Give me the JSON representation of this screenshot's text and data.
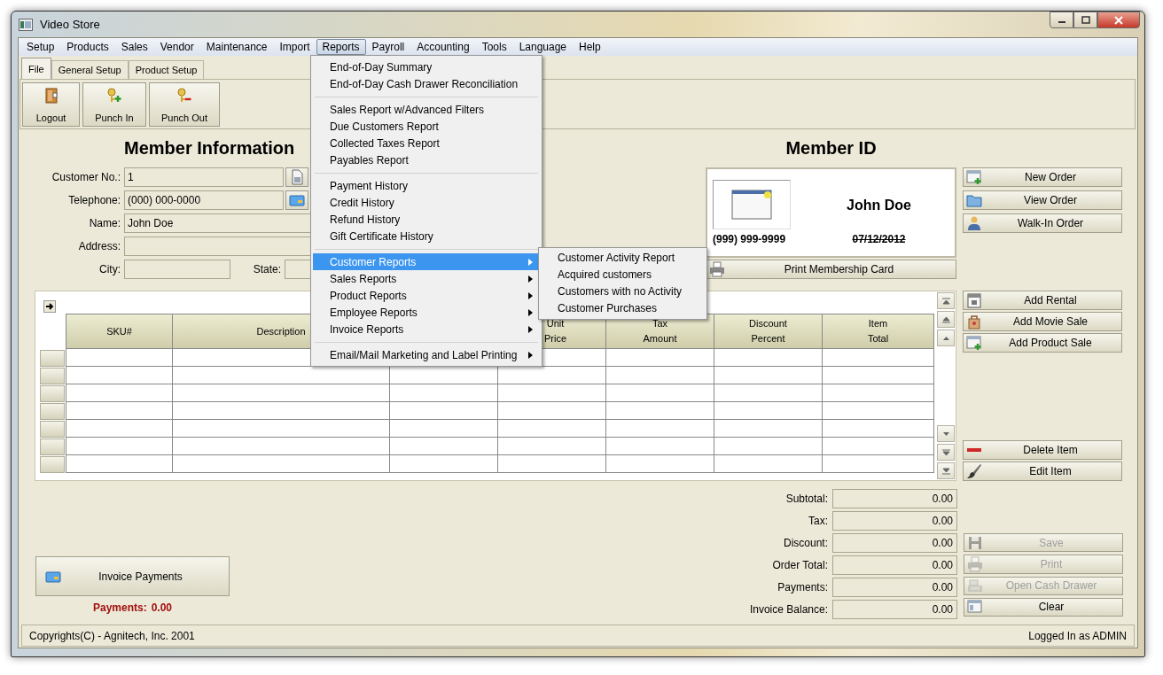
{
  "window": {
    "title": "Video Store"
  },
  "menubar": [
    {
      "label": "Setup",
      "selected": false
    },
    {
      "label": "Products",
      "selected": false
    },
    {
      "label": "Sales",
      "selected": false
    },
    {
      "label": "Vendor",
      "selected": false
    },
    {
      "label": "Maintenance",
      "selected": false
    },
    {
      "label": "Import",
      "selected": false
    },
    {
      "label": "Reports",
      "selected": true
    },
    {
      "label": "Payroll",
      "selected": false
    },
    {
      "label": "Accounting",
      "selected": false
    },
    {
      "label": "Tools",
      "selected": false
    },
    {
      "label": "Language",
      "selected": false
    },
    {
      "label": "Help",
      "selected": false
    }
  ],
  "reports_menu": {
    "groups": [
      [
        {
          "label": "End-of-Day Summary",
          "selected": false,
          "submenu": false
        },
        {
          "label": "End-of-Day Cash Drawer Reconciliation",
          "selected": false,
          "submenu": false
        }
      ],
      [
        {
          "label": "Sales Report w/Advanced Filters",
          "selected": false,
          "submenu": false
        },
        {
          "label": "Due Customers Report",
          "selected": false,
          "submenu": false
        },
        {
          "label": "Collected Taxes Report",
          "selected": false,
          "submenu": false
        },
        {
          "label": "Payables Report",
          "selected": false,
          "submenu": false
        }
      ],
      [
        {
          "label": "Payment History",
          "selected": false,
          "submenu": false
        },
        {
          "label": "Credit History",
          "selected": false,
          "submenu": false
        },
        {
          "label": "Refund History",
          "selected": false,
          "submenu": false
        },
        {
          "label": "Gift Certificate History",
          "selected": false,
          "submenu": false
        }
      ],
      [
        {
          "label": "Customer Reports",
          "selected": true,
          "submenu": true
        },
        {
          "label": "Sales Reports",
          "selected": false,
          "submenu": true
        },
        {
          "label": "Product Reports",
          "selected": false,
          "submenu": true
        },
        {
          "label": "Employee Reports",
          "selected": false,
          "submenu": true
        },
        {
          "label": "Invoice Reports",
          "selected": false,
          "submenu": true
        }
      ],
      [
        {
          "label": "Email/Mail Marketing and Label Printing",
          "selected": false,
          "submenu": true
        }
      ]
    ]
  },
  "customer_reports_submenu": [
    "Customer Activity Report",
    "Acquired customers",
    "Customers with no Activity",
    "Customer Purchases"
  ],
  "tabs": [
    {
      "label": "File",
      "selected": true
    },
    {
      "label": "General Setup",
      "selected": false
    },
    {
      "label": "Product Setup",
      "selected": false
    }
  ],
  "toolbar": [
    {
      "label": "Logout",
      "kind": "door"
    },
    {
      "label": "Punch In",
      "kind": "key-plus"
    },
    {
      "label": "Punch Out",
      "kind": "key-minus"
    }
  ],
  "member_info": {
    "heading": "Member Information",
    "fields": [
      {
        "label": "Customer No.:",
        "value": "1",
        "kind": "doc"
      },
      {
        "label": "Telephone:",
        "value": "(000) 000-0000",
        "kind": "card"
      },
      {
        "label": "Name:",
        "value": "John Doe",
        "kind": "wide"
      },
      {
        "label": "Address:",
        "kind": "wide"
      },
      {
        "label": "City:",
        "kind": "city"
      }
    ],
    "state_label": "State:"
  },
  "member_id": {
    "heading": "Member ID",
    "name": "John Doe",
    "phone": "(999) 999-9999",
    "date": "07/12/2012",
    "print_button": "Print Membership Card"
  },
  "order_buttons": [
    {
      "label": "New Order",
      "kind": "new-window"
    },
    {
      "label": "View Order",
      "kind": "folder"
    },
    {
      "label": "Walk-In Order",
      "kind": "person"
    }
  ],
  "item_buttons": [
    {
      "label": "Add Rental",
      "kind": "calendar"
    },
    {
      "label": "Add Movie Sale",
      "kind": "bag"
    },
    {
      "label": "Add Product Sale",
      "kind": "new-window"
    }
  ],
  "edit_buttons": [
    {
      "label": "Delete Item",
      "kind": "minus"
    },
    {
      "label": "Edit Item",
      "kind": "brush"
    }
  ],
  "table": {
    "columns": [
      {
        "lines": [
          "SKU#"
        ]
      },
      {
        "lines": [
          "Description"
        ]
      },
      {},
      {
        "lines": [
          "Unit",
          "Price"
        ]
      },
      {
        "lines": [
          "Tax",
          "Amount"
        ]
      },
      {
        "lines": [
          "Discount",
          "Percent"
        ]
      },
      {
        "lines": [
          "Item",
          "Total"
        ]
      }
    ]
  },
  "totals": [
    {
      "label": "Subtotal:",
      "value": "0.00"
    },
    {
      "label": "Tax:",
      "value": "0.00"
    },
    {
      "label": "Discount:",
      "value": "0.00"
    },
    {
      "label": "Order Total:",
      "value": "0.00"
    },
    {
      "label": "Payments:",
      "value": "0.00"
    },
    {
      "label": "Invoice Balance:",
      "value": "0.00"
    }
  ],
  "action_buttons": [
    {
      "label": "Save",
      "kind": "floppy",
      "disabled": true
    },
    {
      "label": "Print",
      "kind": "printer",
      "disabled": true
    },
    {
      "label": "Open Cash Drawer",
      "kind": "register",
      "disabled": true
    },
    {
      "label": "Clear",
      "kind": "window",
      "disabled": false
    }
  ],
  "invoice_payments": {
    "button": "Invoice Payments",
    "payments_label": "Payments:",
    "payments_value": "0.00"
  },
  "status_bar": {
    "left": "Copyrights(C) - Agnitech, Inc. 2001",
    "right": "Logged In as ADMIN"
  }
}
